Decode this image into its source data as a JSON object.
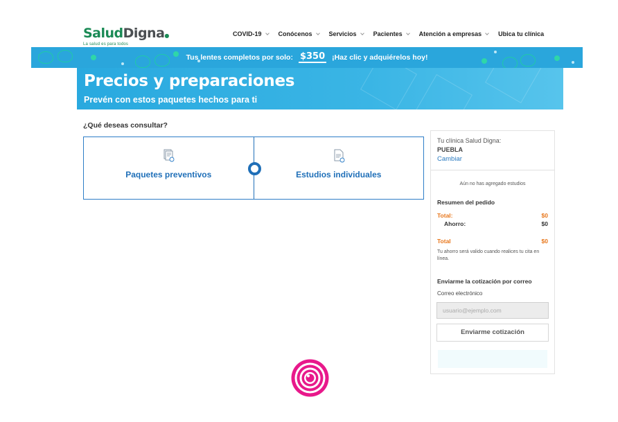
{
  "brand": {
    "name_part1": "Salud",
    "name_part2": "Digna",
    "tagline": "La salud es para todos"
  },
  "nav": [
    {
      "label": "COVID-19",
      "dropdown": true
    },
    {
      "label": "Conócenos",
      "dropdown": true
    },
    {
      "label": "Servicios",
      "dropdown": true
    },
    {
      "label": "Pacientes",
      "dropdown": true
    },
    {
      "label": "Atención a empresas",
      "dropdown": true
    },
    {
      "label": "Ubica tu clínica",
      "dropdown": false
    }
  ],
  "promo": {
    "text_before": "Tus lentes completos por solo:",
    "price": "$350",
    "text_after": "¡Haz clic y adquiérelos hoy!"
  },
  "hero": {
    "title": "Precios y preparaciones",
    "subtitle": "Prevén con estos paquetes hechos para ti"
  },
  "question": "¿Qué deseas consultar?",
  "options": [
    {
      "label": "Paquetes preventivos",
      "icon": "document-stack-icon"
    },
    {
      "label": "Estudios individuales",
      "icon": "document-settings-icon"
    }
  ],
  "sidebar": {
    "clinic_label": "Tu clínica Salud Digna:",
    "clinic_city": "PUEBLA",
    "change_label": "Cambiar",
    "empty_message": "Aún no has agregado estudios",
    "summary_title": "Resumen del pedido",
    "total_label": "Total:",
    "total_value": "$0",
    "savings_label": "Ahorro:",
    "savings_value": "$0",
    "grand_total_label": "Total",
    "grand_total_value": "$0",
    "note": "Tu ahorro será valido cuando realices tu cita en línea.",
    "email_title": "Enviarme la cotización por correo",
    "email_label": "Correo electrónico",
    "email_placeholder": "usuario@ejemplo.com",
    "send_button": "Enviarme cotización"
  },
  "colors": {
    "brand_green": "#1a8a55",
    "primary_blue": "#1f6fb8",
    "banner_blue": "#2aa6dc",
    "accent_orange": "#e8761a",
    "loader_pink": "#e8198b"
  }
}
